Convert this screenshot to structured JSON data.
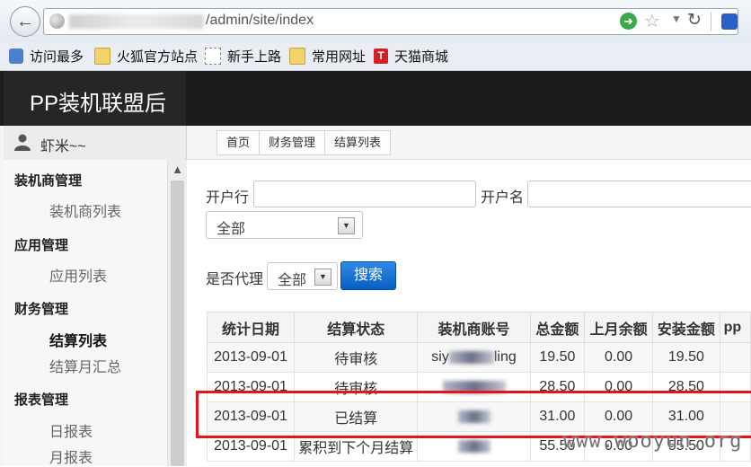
{
  "browser": {
    "url_visible": "/admin/site/index",
    "bookmarks": [
      {
        "label": "访问最多",
        "icon": "magnifier-bookmark-icon"
      },
      {
        "label": "火狐官方站点",
        "icon": "folder-icon"
      },
      {
        "label": "新手上路",
        "icon": "dashed-page-icon"
      },
      {
        "label": "常用网址",
        "icon": "folder-icon"
      },
      {
        "label": "天猫商城",
        "icon": "tmall-icon"
      }
    ],
    "tmall_glyph": "T"
  },
  "app": {
    "brand": "PP装机联盟后"
  },
  "user": {
    "name": "虾米~~"
  },
  "sidebar": {
    "sections": [
      {
        "title": "装机商管理",
        "items": [
          "装机商列表"
        ]
      },
      {
        "title": "应用管理",
        "items": [
          "应用列表"
        ]
      },
      {
        "title": "财务管理",
        "items": [
          "结算列表",
          "结算月汇总"
        ]
      },
      {
        "title": "报表管理",
        "items": [
          "日报表",
          "月报表"
        ]
      }
    ],
    "active_item": "结算列表"
  },
  "breadcrumb": [
    "首页",
    "财务管理",
    "结算列表"
  ],
  "filters": {
    "bank_label": "开户行",
    "account_name_label": "开户名",
    "status_select": "全部",
    "agent_label": "是否代理",
    "agent_select": "全部",
    "search_button": "搜索"
  },
  "table": {
    "columns": [
      "统计日期",
      "结算状态",
      "装机商账号",
      "总金额",
      "上月余额",
      "安装金额",
      "pp"
    ],
    "rows": [
      {
        "date": "2013-09-01",
        "status": "待审核",
        "account_prefix": "siy",
        "account_suffix": "ling",
        "total": "19.50",
        "last_balance": "0.00",
        "install": "19.50"
      },
      {
        "date": "2013-09-01",
        "status": "待审核",
        "account_prefix": "",
        "account_suffix": "",
        "total": "28.50",
        "last_balance": "0.00",
        "install": "28.50"
      },
      {
        "date": "2013-09-01",
        "status": "已结算",
        "account_prefix": "",
        "account_suffix": "",
        "total": "31.00",
        "last_balance": "0.00",
        "install": "31.00"
      },
      {
        "date": "2013-09-01",
        "status": "累积到下个月结算",
        "account_prefix": "",
        "account_suffix": "",
        "total": "55.50",
        "last_balance": "0.00",
        "install": "55.50"
      }
    ]
  },
  "watermark": "www.wooyun.org",
  "colors": {
    "header_bg": "#1b1b1b",
    "primary_button": "#0a5ec4",
    "highlight": "#e8121b"
  }
}
